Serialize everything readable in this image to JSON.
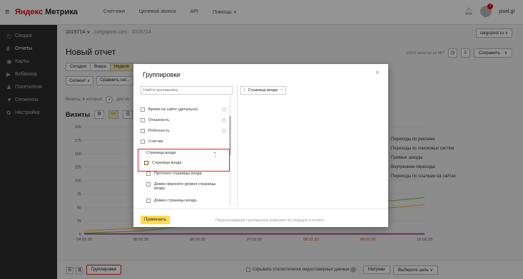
{
  "header": {
    "logo_ya": "Яндекс",
    "logo_rest": " Метрика",
    "nav": [
      "Счетчики",
      "Целевой звонок",
      "API",
      "Помощь ∨"
    ],
    "notif_count": "7",
    "username": "pixel.gl"
  },
  "sidebar": {
    "items": [
      {
        "icon": "◴",
        "label": "Сводка"
      },
      {
        "icon": "ıl",
        "label": "Отчеты"
      },
      {
        "icon": "▣",
        "label": "Карты"
      },
      {
        "icon": "▶",
        "label": "Вебвизор"
      },
      {
        "icon": "♟",
        "label": "Посетители"
      },
      {
        "icon": "▼",
        "label": "Сегменты"
      },
      {
        "icon": "✿",
        "label": "Настройка"
      }
    ]
  },
  "page": {
    "counter_id": "1015714 ∨",
    "counter_site": "cargopost.com · 1015714",
    "site_select": "cargopost.ru ∨",
    "title": "Новый отчет",
    "visits_pct": "100% визитов из 867",
    "save_label": "Сохранить",
    "period": [
      "Сегодня",
      "Вчера",
      "Неделя"
    ],
    "segment_btn": "Сегмент ∨",
    "compare_btn": "Сравнить сег...",
    "visits_filter": "Визиты, в которых",
    "visits_filter2": "для ко...",
    "metric_title": "Визиты"
  },
  "chart_data": {
    "type": "line",
    "title": "",
    "x": [
      "04.02.20",
      "05.02.20",
      "06.02.20",
      "07.02.20",
      "08.02.20",
      "09.02.20",
      "10.02.20"
    ],
    "x_weekend_color": "#c0392b",
    "ylim": [
      0,
      200
    ],
    "yticks": [
      0,
      25,
      50,
      75,
      100,
      125,
      150,
      175,
      200
    ],
    "series": [
      {
        "name": "Переходы по рекламе",
        "color": "#7cbf3d",
        "values": [
          2,
          6,
          18,
          30,
          45,
          58,
          68
        ]
      },
      {
        "name": "Переходы из поисковых систем",
        "color": "#f0b53a",
        "values": [
          6,
          12,
          18,
          24,
          35,
          45,
          55
        ]
      },
      {
        "name": "Прямые заходы",
        "color": "#d83a3a",
        "values": [
          1,
          1,
          1,
          1,
          1,
          1,
          1
        ]
      },
      {
        "name": "Внутренние переходы",
        "color": "#5ba4e0",
        "values": [
          0,
          0,
          0,
          0,
          0,
          0,
          0
        ]
      },
      {
        "name": "Переходы по ссылкам на сайтах",
        "color": "#8e44ad",
        "values": [
          0,
          0,
          0,
          0,
          0,
          0,
          0
        ]
      }
    ]
  },
  "bottom": {
    "groupings_btn": "Группировки",
    "hide_stat": "Скрывать статистически недостоверные данные",
    "metrics_btn": "Метрики",
    "goal_btn": "Выберите цель ∨"
  },
  "modal": {
    "title": "Группировки",
    "close": "×",
    "search_placeholder": "Найти группировку",
    "chip": "Страница входа",
    "chip_close": "×",
    "list": [
      {
        "label": "Время на сайте (детально)",
        "q": "?"
      },
      {
        "label": "Отказность",
        "q": "?"
      },
      {
        "label": "Роботность",
        "q": "?"
      },
      {
        "label": "Счетчик",
        "q": ""
      }
    ],
    "group_head": "Страница входа",
    "group_head_icons": "◐ ⌃",
    "sub_items": [
      {
        "label": "Страница входа",
        "checked": true
      },
      {
        "label": "Протокол страницы входа",
        "checked": false
      },
      {
        "label": "Домен верхнего уровня страницы входа",
        "checked": false
      },
      {
        "label": "Домен страницы входа",
        "checked": false
      }
    ],
    "apply": "Применить",
    "hint": "Перетаскивание группировок изменяет их порядок в отчете."
  }
}
